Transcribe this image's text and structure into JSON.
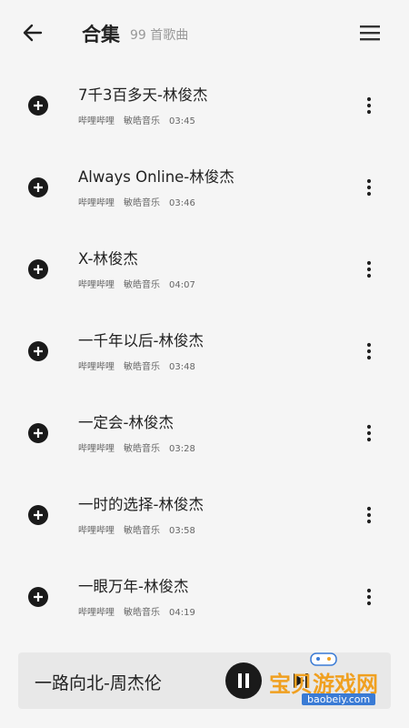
{
  "header": {
    "title": "合集",
    "count": "99 首歌曲",
    "back_icon": "arrow-left-icon",
    "menu_icon": "hamburger-menu-icon"
  },
  "songs": [
    {
      "title": "7千3百多天-林俊杰",
      "source": "哔哩哔哩",
      "artist_label": "敏皓音乐",
      "duration": "03:45"
    },
    {
      "title": "Always Online-林俊杰",
      "source": "哔哩哔哩",
      "artist_label": "敏皓音乐",
      "duration": "03:46"
    },
    {
      "title": "X-林俊杰",
      "source": "哔哩哔哩",
      "artist_label": "敏皓音乐",
      "duration": "04:07"
    },
    {
      "title": "一千年以后-林俊杰",
      "source": "哔哩哔哩",
      "artist_label": "敏皓音乐",
      "duration": "03:48"
    },
    {
      "title": "一定会-林俊杰",
      "source": "哔哩哔哩",
      "artist_label": "敏皓音乐",
      "duration": "03:28"
    },
    {
      "title": "一时的选择-林俊杰",
      "source": "哔哩哔哩",
      "artist_label": "敏皓音乐",
      "duration": "03:58"
    },
    {
      "title": "一眼万年-林俊杰",
      "source": "哔哩哔哩",
      "artist_label": "敏皓音乐",
      "duration": "04:19"
    }
  ],
  "player": {
    "now_playing": "一路向北-周杰伦",
    "play_icon": "pause-icon",
    "next_icon": "skip-next-icon"
  },
  "watermark": {
    "text": "宝贝游戏网",
    "url": "baobeiy.com"
  },
  "colors": {
    "background": "#f5f5f5",
    "player_bar": "#e8e8e8",
    "watermark_text": "#f0a020"
  }
}
